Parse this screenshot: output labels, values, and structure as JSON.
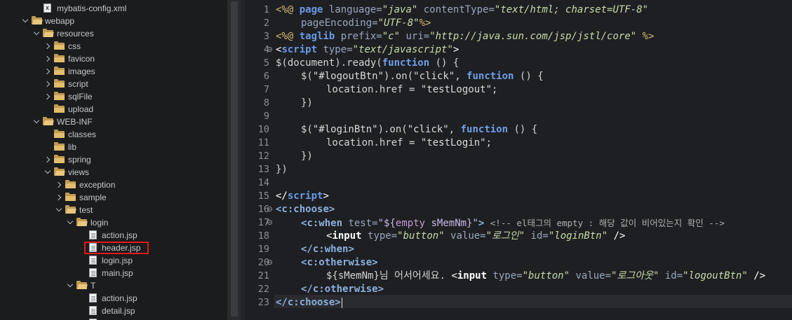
{
  "explorer": {
    "items": [
      {
        "label": "mybatis-config.xml",
        "type": "xml"
      },
      {
        "label": "webapp",
        "type": "folder-open"
      },
      {
        "label": "resources",
        "type": "folder-open"
      },
      {
        "label": "css",
        "type": "folder-closed"
      },
      {
        "label": "favicon",
        "type": "folder-closed"
      },
      {
        "label": "images",
        "type": "folder-closed"
      },
      {
        "label": "script",
        "type": "folder-closed"
      },
      {
        "label": "sqlFile",
        "type": "folder-closed"
      },
      {
        "label": "upload",
        "type": "folder"
      },
      {
        "label": "WEB-INF",
        "type": "folder-open"
      },
      {
        "label": "classes",
        "type": "folder"
      },
      {
        "label": "lib",
        "type": "folder"
      },
      {
        "label": "spring",
        "type": "folder-closed"
      },
      {
        "label": "views",
        "type": "folder-open"
      },
      {
        "label": "exception",
        "type": "folder-closed"
      },
      {
        "label": "sample",
        "type": "folder-closed"
      },
      {
        "label": "test",
        "type": "folder-open"
      },
      {
        "label": "login",
        "type": "folder-open"
      },
      {
        "label": "action.jsp",
        "type": "file"
      },
      {
        "label": "header.jsp",
        "type": "file",
        "highlighted": true
      },
      {
        "label": "login.jsp",
        "type": "file"
      },
      {
        "label": "main.jsp",
        "type": "file"
      },
      {
        "label": "T",
        "type": "folder-open"
      },
      {
        "label": "action.jsp",
        "type": "file"
      },
      {
        "label": "detail.jsp",
        "type": "file"
      }
    ]
  },
  "editor": {
    "line_numbers": [
      "1",
      "2",
      "3",
      "4",
      "5",
      "6",
      "7",
      "8",
      "9",
      "10",
      "11",
      "12",
      "13",
      "14",
      "15",
      "16",
      "17",
      "18",
      "19",
      "20",
      "21",
      "22",
      "23"
    ],
    "code": {
      "l1": [
        "<%@ ",
        "page ",
        "language=",
        "\"java\" ",
        "contentType=",
        "\"text/html; charset=UTF-8\""
      ],
      "l2": [
        "pageEncoding=",
        "\"UTF-8\"",
        "%>"
      ],
      "l3": [
        "<%@ ",
        "taglib ",
        "prefix=",
        "\"c\" ",
        "uri=",
        "\"http://java.sun.com/jsp/jstl/core\" ",
        "%>"
      ],
      "l4": [
        "<",
        "script ",
        "type=",
        "\"text/javascript\"",
        ">"
      ],
      "l5": [
        "$(document).ready(",
        "function",
        " () {"
      ],
      "l6": [
        "$(",
        "\"#logoutBtn\"",
        ").on(",
        "\"click\"",
        ", ",
        "function",
        " () {"
      ],
      "l7": [
        "location.href = ",
        "\"testLogout\"",
        ";"
      ],
      "l8": [
        "})"
      ],
      "l10": [
        "$(",
        "\"#loginBtn\"",
        ").on(",
        "\"click\"",
        ", ",
        "function",
        " () {"
      ],
      "l11": [
        "location.href = ",
        "\"testLogin\"",
        ";"
      ],
      "l12": [
        "})"
      ],
      "l13": [
        "})"
      ],
      "l15": [
        "</",
        "script",
        ">"
      ],
      "l16": [
        "<",
        "c:choose",
        ">"
      ],
      "l17": [
        "<",
        "c:when ",
        "test=",
        "\"${",
        "empty ",
        "sMemNm}\"",
        "> ",
        "<!-- el태그의 empty : 해당 값이 비어있는지 확인 -->"
      ],
      "l18": [
        "<",
        "input ",
        "type=",
        "\"button\" ",
        "value=",
        "\"로그인\" ",
        "id=",
        "\"loginBtn\" ",
        "/>"
      ],
      "l19": [
        "</",
        "c:when",
        ">"
      ],
      "l20": [
        "<",
        "c:otherwise",
        ">"
      ],
      "l21": [
        "${sMemNm}님 어서어세요. ",
        "<",
        "input ",
        "type=",
        "\"button\" ",
        "value=",
        "\"로그아웃\" ",
        "id=",
        "\"logoutBtn\" ",
        "/>"
      ],
      "l22": [
        "</",
        "c:otherwise",
        ">"
      ],
      "l23": [
        "</",
        "c:choose",
        ">"
      ]
    }
  },
  "colors": {
    "editor_bg": "#1e1f22",
    "highlight_border": "#e0191c",
    "keyword": "#6a9be8",
    "string": "#b5cea8"
  }
}
